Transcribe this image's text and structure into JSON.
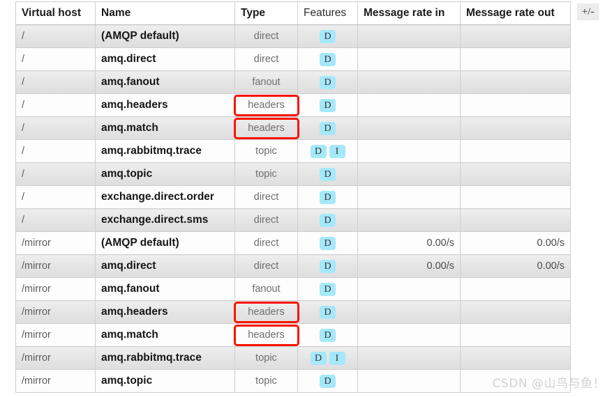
{
  "table": {
    "columns": [
      {
        "key": "vhost",
        "label": "Virtual host",
        "sortable": true,
        "bold": true
      },
      {
        "key": "name",
        "label": "Name",
        "sortable": true,
        "bold": true
      },
      {
        "key": "type",
        "label": "Type",
        "sortable": true,
        "bold": true
      },
      {
        "key": "feat",
        "label": "Features",
        "sortable": false,
        "bold": false
      },
      {
        "key": "rin",
        "label": "Message rate in",
        "sortable": true,
        "bold": true
      },
      {
        "key": "rout",
        "label": "Message rate out",
        "sortable": true,
        "bold": true
      }
    ],
    "rows": [
      {
        "vhost": "/",
        "name": "(AMQP default)",
        "type": "direct",
        "features": [
          "D"
        ],
        "rate_in": "",
        "rate_out": "",
        "type_highlighted": false
      },
      {
        "vhost": "/",
        "name": "amq.direct",
        "type": "direct",
        "features": [
          "D"
        ],
        "rate_in": "",
        "rate_out": "",
        "type_highlighted": false
      },
      {
        "vhost": "/",
        "name": "amq.fanout",
        "type": "fanout",
        "features": [
          "D"
        ],
        "rate_in": "",
        "rate_out": "",
        "type_highlighted": false
      },
      {
        "vhost": "/",
        "name": "amq.headers",
        "type": "headers",
        "features": [
          "D"
        ],
        "rate_in": "",
        "rate_out": "",
        "type_highlighted": true
      },
      {
        "vhost": "/",
        "name": "amq.match",
        "type": "headers",
        "features": [
          "D"
        ],
        "rate_in": "",
        "rate_out": "",
        "type_highlighted": true
      },
      {
        "vhost": "/",
        "name": "amq.rabbitmq.trace",
        "type": "topic",
        "features": [
          "D",
          "I"
        ],
        "rate_in": "",
        "rate_out": "",
        "type_highlighted": false
      },
      {
        "vhost": "/",
        "name": "amq.topic",
        "type": "topic",
        "features": [
          "D"
        ],
        "rate_in": "",
        "rate_out": "",
        "type_highlighted": false
      },
      {
        "vhost": "/",
        "name": "exchange.direct.order",
        "type": "direct",
        "features": [
          "D"
        ],
        "rate_in": "",
        "rate_out": "",
        "type_highlighted": false
      },
      {
        "vhost": "/",
        "name": "exchange.direct.sms",
        "type": "direct",
        "features": [
          "D"
        ],
        "rate_in": "",
        "rate_out": "",
        "type_highlighted": false
      },
      {
        "vhost": "/mirror",
        "name": "(AMQP default)",
        "type": "direct",
        "features": [
          "D"
        ],
        "rate_in": "0.00/s",
        "rate_out": "0.00/s",
        "type_highlighted": false
      },
      {
        "vhost": "/mirror",
        "name": "amq.direct",
        "type": "direct",
        "features": [
          "D"
        ],
        "rate_in": "0.00/s",
        "rate_out": "0.00/s",
        "type_highlighted": false
      },
      {
        "vhost": "/mirror",
        "name": "amq.fanout",
        "type": "fanout",
        "features": [
          "D"
        ],
        "rate_in": "",
        "rate_out": "",
        "type_highlighted": false
      },
      {
        "vhost": "/mirror",
        "name": "amq.headers",
        "type": "headers",
        "features": [
          "D"
        ],
        "rate_in": "",
        "rate_out": "",
        "type_highlighted": true
      },
      {
        "vhost": "/mirror",
        "name": "amq.match",
        "type": "headers",
        "features": [
          "D"
        ],
        "rate_in": "",
        "rate_out": "",
        "type_highlighted": true
      },
      {
        "vhost": "/mirror",
        "name": "amq.rabbitmq.trace",
        "type": "topic",
        "features": [
          "D",
          "I"
        ],
        "rate_in": "",
        "rate_out": "",
        "type_highlighted": false
      },
      {
        "vhost": "/mirror",
        "name": "amq.topic",
        "type": "topic",
        "features": [
          "D"
        ],
        "rate_in": "",
        "rate_out": "",
        "type_highlighted": false
      }
    ]
  },
  "toggle_columns": {
    "label": "+/-"
  },
  "watermark": {
    "text": "CSDN @山鸟与鱼！"
  },
  "colors": {
    "highlight_box": "#fb1400",
    "feature_badge_bg": "#a5e8fa",
    "row_alt_bg": "#e6e6e6",
    "row_bg": "#fdfdfd",
    "border": "#cfcfcf"
  }
}
